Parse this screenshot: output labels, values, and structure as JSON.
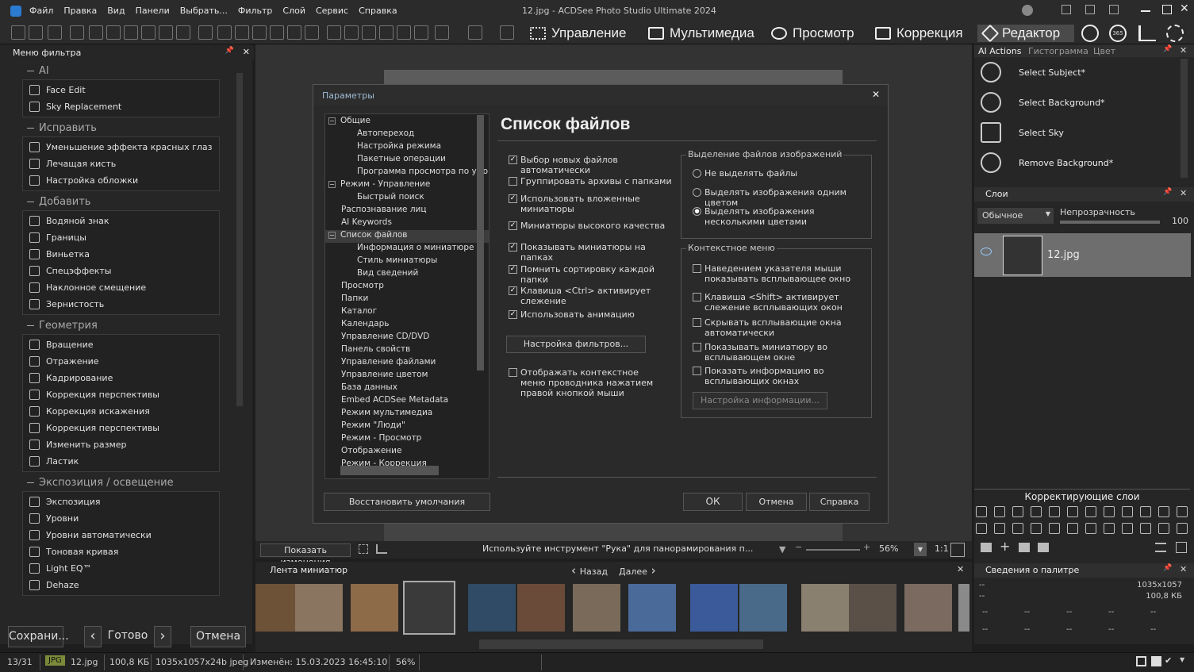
{
  "window": {
    "title": "12.jpg - ACDSee Photo Studio Ultimate 2024"
  },
  "menu": [
    "Файл",
    "Правка",
    "Вид",
    "Панели",
    "Выбрать...",
    "Фильтр",
    "Слой",
    "Сервис",
    "Справка"
  ],
  "modes": [
    {
      "label": "Управление",
      "icon": "grid-icon"
    },
    {
      "label": "Мультимедиа",
      "icon": "film-icon"
    },
    {
      "label": "Просмотр",
      "icon": "eye-icon"
    },
    {
      "label": "Коррекция",
      "icon": "develop-icon"
    },
    {
      "label": "Редактор",
      "icon": "edit-icon"
    }
  ],
  "filter_menu": {
    "title": "Меню фильтра",
    "groups": [
      {
        "title": "AI",
        "items": [
          "Face Edit",
          "Sky Replacement"
        ]
      },
      {
        "title": "Исправить",
        "items": [
          "Уменьшение эффекта красных глаз",
          "Лечащая кисть",
          "Настройка обложки"
        ]
      },
      {
        "title": "Добавить",
        "items": [
          "Водяной знак",
          "Границы",
          "Виньетка",
          "Спецэффекты",
          "Наклонное смещение",
          "Зернистость"
        ]
      },
      {
        "title": "Геометрия",
        "items": [
          "Вращение",
          "Отражение",
          "Кадрирование",
          "Коррекция перспективы",
          "Коррекция искажения",
          "Коррекция перспективы",
          "Изменить размер",
          "Ластик"
        ]
      },
      {
        "title": "Экспозиция / освещение",
        "items": [
          "Экспозиция",
          "Уровни",
          "Уровни автоматически",
          "Тоновая кривая",
          "Light EQ™",
          "Dehaze"
        ]
      }
    ]
  },
  "left_bottom": {
    "save": "Сохрани...",
    "done": "Готово",
    "cancel": "Отмена"
  },
  "dialog": {
    "title": "Параметры",
    "heading": "Список файлов",
    "tree": [
      {
        "label": "Общие",
        "level": 0,
        "box": "⊟"
      },
      {
        "label": "Автопереход",
        "level": 2
      },
      {
        "label": "Настройка режима",
        "level": 2
      },
      {
        "label": "Пакетные операции",
        "level": 2
      },
      {
        "label": "Программа просмотра по умо",
        "level": 2
      },
      {
        "label": "Режим - Управление",
        "level": 0,
        "box": "⊟"
      },
      {
        "label": "Быстрый поиск",
        "level": 2
      },
      {
        "label": "Распознавание лиц",
        "level": 1
      },
      {
        "label": "AI Keywords",
        "level": 1
      },
      {
        "label": "Список файлов",
        "level": 0,
        "box": "⊟",
        "selected": true
      },
      {
        "label": "Информация о миниатюре",
        "level": 2
      },
      {
        "label": "Стиль миниатюры",
        "level": 2
      },
      {
        "label": "Вид сведений",
        "level": 2
      },
      {
        "label": "Просмотр",
        "level": 1
      },
      {
        "label": "Папки",
        "level": 1
      },
      {
        "label": "Каталог",
        "level": 1
      },
      {
        "label": "Календарь",
        "level": 1
      },
      {
        "label": "Управление CD/DVD",
        "level": 1
      },
      {
        "label": "Панель свойств",
        "level": 1
      },
      {
        "label": "Управление файлами",
        "level": 1
      },
      {
        "label": "Управление цветом",
        "level": 1
      },
      {
        "label": "База данных",
        "level": 1
      },
      {
        "label": "Embed ACDSee Metadata",
        "level": 1
      },
      {
        "label": "Режим мультимедиа",
        "level": 1
      },
      {
        "label": "Режим \"Люди\"",
        "level": 1
      },
      {
        "label": "Режим - Просмотр",
        "level": 1
      },
      {
        "label": "Отображение",
        "level": 1
      },
      {
        "label": "Режим - Коррекция",
        "level": 1
      }
    ],
    "options": [
      {
        "label": "Выбор новых файлов автоматически",
        "checked": true
      },
      {
        "label": "Группировать архивы с папками",
        "checked": false
      },
      {
        "label": "Использовать вложенные миниатюры",
        "checked": true
      },
      {
        "label": "Миниатюры высокого качества",
        "checked": true
      },
      {
        "label": "Показывать миниатюры на папках",
        "checked": true
      },
      {
        "label": "Помнить сортировку каждой папки",
        "checked": true
      },
      {
        "label": "Клавиша <Ctrl> активирует слежение",
        "checked": true
      },
      {
        "label": "Использовать анимацию",
        "checked": true
      }
    ],
    "filter_btn": "Настройка фильтров...",
    "context_opt": {
      "label": "Отображать контекстное меню проводника нажатием правой кнопкой мыши",
      "checked": false
    },
    "selection_group": {
      "title": "Выделение файлов изображений",
      "options": [
        {
          "label": "Не выделять файлы",
          "selected": false
        },
        {
          "label": "Выделять изображения одним цветом",
          "selected": false
        },
        {
          "label": "Выделять изображения несколькими цветами",
          "selected": true
        }
      ]
    },
    "context_group": {
      "title": "Контекстное меню",
      "options": [
        {
          "label": "Наведением указателя мыши показывать всплывающее окно",
          "checked": false
        },
        {
          "label": "Клавиша <Shift> активирует слежение всплывающих окон",
          "checked": false
        },
        {
          "label": "Скрывать всплывающие окна автоматически",
          "checked": false
        },
        {
          "label": "Показывать миниатюру во всплывающем окне",
          "checked": false
        },
        {
          "label": "Показать информацию во всплывающих окнах",
          "checked": false
        }
      ],
      "info_btn": "Настройка информации..."
    },
    "restore_btn": "Восстановить умолчания",
    "ok": "ОК",
    "cancel": "Отмена",
    "help": "Справка"
  },
  "view_bar": {
    "show_changes": "Показать изменения",
    "hint": "Используйте инструмент \"Рука\" для панорамирования п...",
    "zoom": "56%",
    "ratio": "1:1"
  },
  "filmstrip": {
    "title": "Лента миниатюр",
    "back": "Назад",
    "next": "Далее"
  },
  "ai_actions": {
    "tabs": [
      "AI Actions",
      "Гистограмма",
      "Цвет"
    ],
    "items": [
      "Select Subject*",
      "Select Background*",
      "Select Sky",
      "Remove Background*"
    ]
  },
  "layers": {
    "title": "Слои",
    "blend": "Обычное",
    "opacity_label": "Непрозрачность",
    "opacity": "100",
    "layer_name": "12.jpg"
  },
  "adjust_layers": {
    "title": "Корректирующие слои"
  },
  "palette_info": {
    "title": "Сведения о палитре",
    "dims": "1035x1057",
    "size": "100,8 КБ",
    "dash": "--"
  },
  "status": {
    "count": "13/31",
    "type": "JPG",
    "file": "12.jpg",
    "size": "100,8 КБ",
    "dims": "1035x1057x24b jpeg",
    "modified": "Изменён: 15.03.2023 16:45:10",
    "zoom": "56%"
  }
}
